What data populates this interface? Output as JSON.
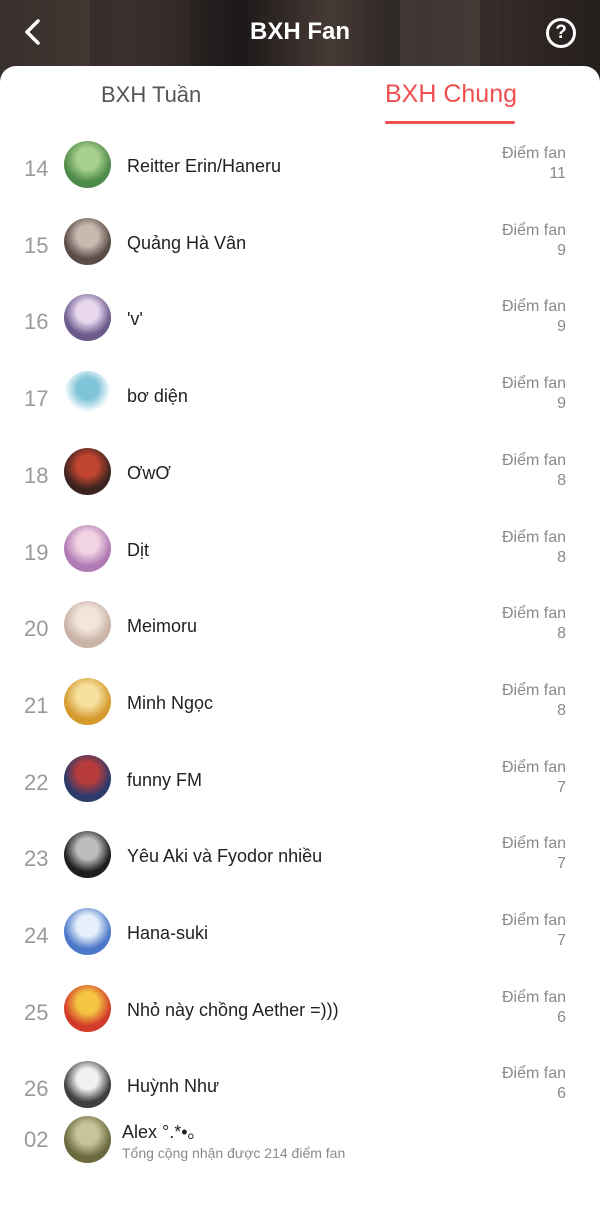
{
  "header": {
    "title": "BXH Fan"
  },
  "tabs": [
    {
      "label": "BXH Tuần",
      "active": false
    },
    {
      "label": "BXH Chung",
      "active": true
    }
  ],
  "score_label": "Điểm fan",
  "entries": [
    {
      "rank": "14",
      "name": "Reitter Erin/Haneru",
      "score": "11",
      "avatar_colors": [
        "#4e8a4a",
        "#a9d18e"
      ]
    },
    {
      "rank": "15",
      "name": "Quảng Hà Vân",
      "score": "9",
      "avatar_colors": [
        "#5a4d48",
        "#c9b9b0"
      ]
    },
    {
      "rank": "16",
      "name": "'v'",
      "score": "9",
      "avatar_colors": [
        "#6b5b8a",
        "#e9d7f0"
      ]
    },
    {
      "rank": "17",
      "name": "bơ diện",
      "score": "9",
      "avatar_colors": [
        "#ffffff",
        "#7fc4d8"
      ]
    },
    {
      "rank": "18",
      "name": "ƠwƠ",
      "score": "8",
      "avatar_colors": [
        "#3b2420",
        "#c2452f"
      ]
    },
    {
      "rank": "19",
      "name": "Dịt",
      "score": "8",
      "avatar_colors": [
        "#b07ab5",
        "#f1d3e2"
      ]
    },
    {
      "rank": "20",
      "name": "Meimoru",
      "score": "8",
      "avatar_colors": [
        "#c9b3a6",
        "#f2e6dc"
      ]
    },
    {
      "rank": "21",
      "name": "Minh Ngọc",
      "score": "8",
      "avatar_colors": [
        "#d49a2e",
        "#f6e1a0"
      ]
    },
    {
      "rank": "22",
      "name": "funny FM",
      "score": "7",
      "avatar_colors": [
        "#2d3b6b",
        "#b83b3b"
      ]
    },
    {
      "rank": "23",
      "name": "Yêu Aki và Fyodor nhiều",
      "score": "7",
      "avatar_colors": [
        "#1f1f1f",
        "#bdbdbd"
      ]
    },
    {
      "rank": "24",
      "name": "Hana-suki",
      "score": "7",
      "avatar_colors": [
        "#4b78c9",
        "#e6f0fb"
      ]
    },
    {
      "rank": "25",
      "name": "Nhỏ này chồng Aether =)))",
      "score": "6",
      "avatar_colors": [
        "#d23b2a",
        "#f5c542"
      ]
    },
    {
      "rank": "26",
      "name": "Huỳnh Như",
      "score": "6",
      "avatar_colors": [
        "#3f3f3f",
        "#f0f0f0"
      ]
    }
  ],
  "me": {
    "rank": "02",
    "name": "Alex °.*•｡",
    "total": "Tổng cộng nhận được 214 điểm fan",
    "avatar_colors": [
      "#6b6a3f",
      "#c9c39a"
    ]
  },
  "colors": {
    "accent": "#ef4f4f",
    "muted": "#8a8a8a"
  }
}
